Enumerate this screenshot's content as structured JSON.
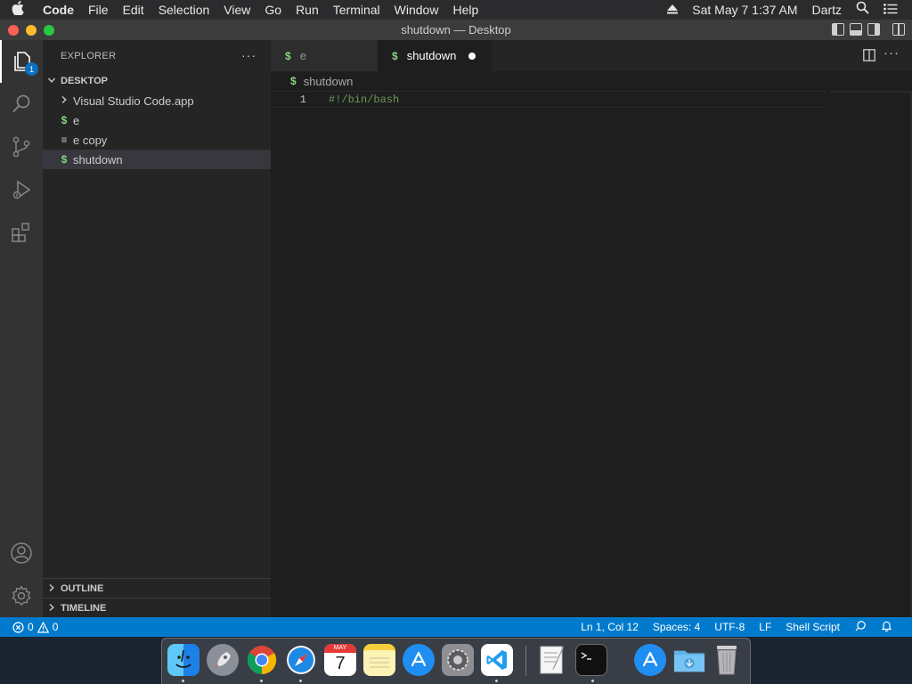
{
  "menubar": {
    "apple_icon": "apple-logo-icon",
    "items": [
      "Code",
      "File",
      "Edit",
      "Selection",
      "View",
      "Go",
      "Run",
      "Terminal",
      "Window",
      "Help"
    ],
    "clock": "Sat May 7  1:37 AM",
    "user": "Dartz"
  },
  "window": {
    "title": "shutdown — Desktop"
  },
  "activitybar": {
    "explorer_badge": "1"
  },
  "sidebar": {
    "title": "EXPLORER",
    "more": "···",
    "folder": "DESKTOP",
    "items": [
      {
        "label": "Visual Studio Code.app",
        "icon": "chevron-right-icon"
      },
      {
        "label": "e",
        "icon": "$"
      },
      {
        "label": "e copy",
        "icon": "≡"
      },
      {
        "label": "shutdown",
        "icon": "$"
      }
    ],
    "outline": "OUTLINE",
    "timeline": "TIMELINE"
  },
  "editor": {
    "tabs": [
      {
        "label": "e",
        "icon": "$"
      },
      {
        "label": "shutdown",
        "icon": "$",
        "modified": true
      }
    ],
    "breadcrumb": "shutdown",
    "lines": [
      {
        "num": "1",
        "text": "#!/bin/bash"
      }
    ]
  },
  "statusbar": {
    "errors": "0",
    "warnings": "0",
    "position": "Ln 1, Col 12",
    "spaces": "Spaces: 4",
    "encoding": "UTF-8",
    "eol": "LF",
    "language": "Shell Script"
  },
  "dock": {
    "apps": [
      "finder",
      "launchpad",
      "chrome",
      "safari",
      "calendar",
      "notes",
      "app-store",
      "system-preferences",
      "vscode",
      "textedit",
      "terminal",
      "app-store-downloads",
      "downloads-folder",
      "trash"
    ],
    "calendar_month": "MAY",
    "calendar_day": "7"
  },
  "colors": {
    "accent": "#007acc",
    "shell_icon": "#89d185"
  }
}
